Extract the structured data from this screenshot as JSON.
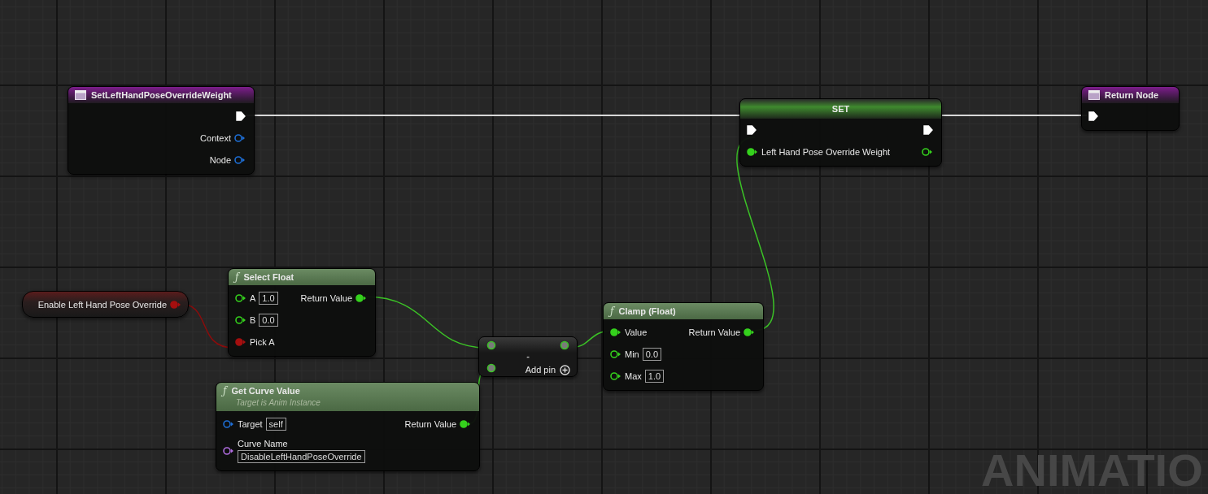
{
  "nodes": [
    {
      "kind": "event",
      "title": "SetLeftHandPoseOverrideWeight",
      "outputs": [
        {
          "kind": "exec",
          "connected": true
        },
        {
          "kind": "struct",
          "label": "Context",
          "connected": false
        },
        {
          "kind": "struct",
          "label": "Node",
          "connected": false
        }
      ]
    },
    {
      "kind": "set",
      "title": "SET",
      "inputs": [
        {
          "kind": "exec",
          "connected": true
        },
        {
          "kind": "float",
          "label": "Left Hand Pose Override Weight",
          "connected": true
        }
      ],
      "outputs": [
        {
          "kind": "exec",
          "connected": true
        },
        {
          "kind": "float",
          "connected": false
        }
      ]
    },
    {
      "kind": "event",
      "title": "Return Node",
      "inputs": [
        {
          "kind": "exec",
          "connected": true
        }
      ]
    },
    {
      "kind": "variable",
      "title": "Enable Left Hand Pose Override",
      "outputs": [
        {
          "kind": "bool",
          "connected": true
        }
      ]
    },
    {
      "kind": "function",
      "glyph": "ƒ",
      "title": "Select Float",
      "inputs": [
        {
          "kind": "float",
          "label": "A",
          "value": "1.0",
          "connected": false
        },
        {
          "kind": "float",
          "label": "B",
          "value": "0.0",
          "connected": false
        },
        {
          "kind": "bool",
          "label": "Pick A",
          "connected": true
        }
      ],
      "outputs": [
        {
          "kind": "float",
          "label": "Return Value",
          "connected": true
        }
      ]
    },
    {
      "kind": "operator",
      "title": "-",
      "add_pin": "Add pin",
      "inputs": [
        {
          "kind": "operand",
          "connected": true
        },
        {
          "kind": "operand",
          "connected": true
        }
      ],
      "outputs": [
        {
          "kind": "operand",
          "connected": true
        }
      ]
    },
    {
      "kind": "function",
      "glyph": "ƒ",
      "title": "Clamp (Float)",
      "inputs": [
        {
          "kind": "float",
          "label": "Value",
          "connected": true
        },
        {
          "kind": "float",
          "label": "Min",
          "value": "0.0",
          "connected": false
        },
        {
          "kind": "float",
          "label": "Max",
          "value": "1.0",
          "connected": false
        }
      ],
      "outputs": [
        {
          "kind": "float",
          "label": "Return Value",
          "connected": true
        }
      ]
    },
    {
      "kind": "function",
      "glyph": "ƒ",
      "title": "Get Curve Value",
      "subtitle": "Target is Anim Instance",
      "inputs": [
        {
          "kind": "struct",
          "label": "Target",
          "value": "self",
          "connected": false
        },
        {
          "kind": "name",
          "label": "Curve Name",
          "value": "DisableLeftHandPoseOverride",
          "connected": false
        }
      ],
      "outputs": [
        {
          "kind": "float",
          "label": "Return Value",
          "connected": true
        }
      ]
    }
  ],
  "graph_label": "ANIMATIO"
}
